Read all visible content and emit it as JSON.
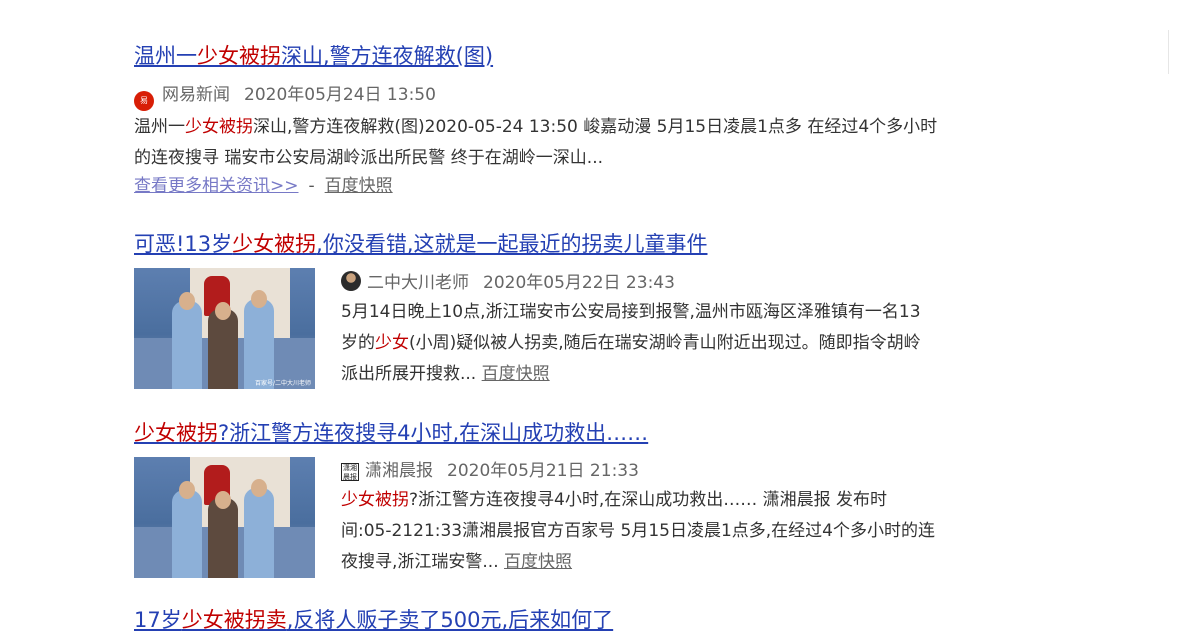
{
  "results": [
    {
      "title_pre": "温州一",
      "title_hl": "少女被拐",
      "title_post": "深山,警方连夜解救(图)",
      "source": "网易新闻",
      "source_icon": "netease-logo-icon",
      "date": "2020年05月24日 13:50",
      "abstract_pre": "温州一",
      "abstract_hl": "少女被拐",
      "abstract_post": "深山,警方连夜解救(图)2020-05-24 13:50 峻嘉动漫 5月15日凌晨1点多 在经过4个多小时的连夜搜寻 瑞安市公安局湖岭派出所民警 终于在湖岭一深山...",
      "more_link": "查看更多相关资讯>>",
      "separator": "-",
      "cache_link": "百度快照"
    },
    {
      "title_pre": "可恶!13岁",
      "title_hl": "少女被拐",
      "title_post": ",你没看错,这就是一起最近的拐卖儿童事件",
      "source": "二中大川老师",
      "source_icon": "author-avatar-icon",
      "date": "2020年05月22日 23:43",
      "abstract_pre": "5月14日晚上10点,浙江瑞安市公安局接到报警,温州市瓯海区泽雅镇有一名13岁的",
      "abstract_hl": "少女",
      "abstract_post": "(小周)疑似被人拐卖,随后在瑞安湖岭青山附近出现过。随即指令胡岭派出所展开搜救...",
      "cache_link": "百度快照",
      "thumb_watermark": "百家号/二中大川老师"
    },
    {
      "title_pre": "",
      "title_hl": "少女被拐",
      "title_post": "?浙江警方连夜搜寻4小时,在深山成功救出……",
      "source": "潇湘晨报",
      "source_icon": "xiaoxiang-logo-icon",
      "date": "2020年05月21日 21:33",
      "abstract_pre": "",
      "abstract_hl": "少女被拐",
      "abstract_post": "?浙江警方连夜搜寻4小时,在深山成功救出…… 潇湘晨报 发布时间:05-2121:33潇湘晨报官方百家号 5月15日凌晨1点多,在经过4个多小时的连夜搜寻,浙江瑞安警...",
      "cache_link": "百度快照"
    },
    {
      "title_pre": "17岁",
      "title_hl": "少女被拐卖",
      "title_post": ",反将人贩子卖了500元,后来如何了"
    }
  ],
  "colors": {
    "title_link": "#2440b3",
    "highlight": "#c00000",
    "more_link": "#7779c6"
  }
}
